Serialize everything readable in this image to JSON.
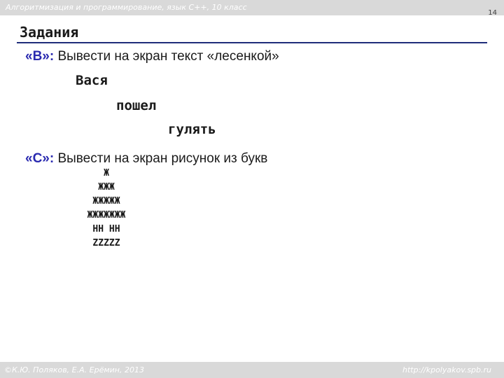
{
  "header": {
    "course": "Алгоритмизация и программирование, язык  C++, 10 класс",
    "page_number": "14"
  },
  "title": "Задания",
  "task_b": {
    "label": "«B»:",
    "text": " Вывести на экран текст «лесенкой»",
    "lines": [
      "Вася",
      "пошел",
      "гулять"
    ]
  },
  "task_c": {
    "label": "«C»:",
    "text": " Вывести на экран рисунок из букв",
    "figure": [
      "Ж",
      "ЖЖЖ",
      "ЖЖЖЖЖ",
      "ЖЖЖЖЖЖЖ",
      "HH HH",
      "ZZZZZ"
    ]
  },
  "footer": {
    "credit": "©К.Ю. Поляков, Е.А. Ерёмин, 2013",
    "site": "http://kpolyakov.spb.ru"
  }
}
